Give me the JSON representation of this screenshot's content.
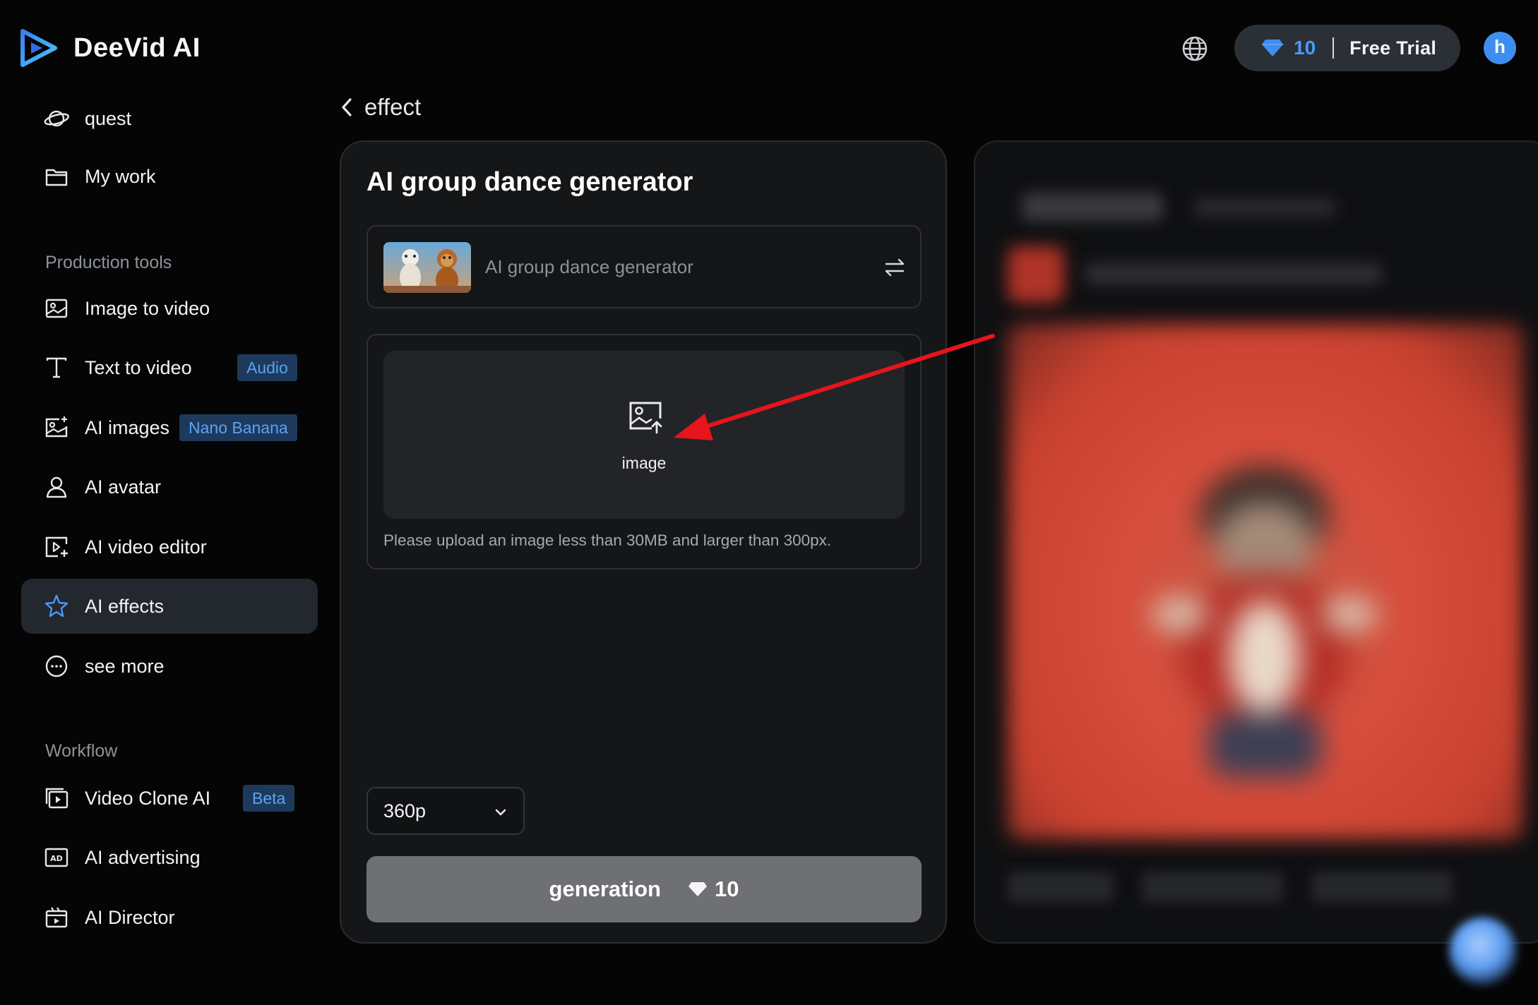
{
  "app": {
    "name": "DeeVid AI"
  },
  "header": {
    "credits": "10",
    "trial_label": "Free Trial",
    "avatar_initial": "h"
  },
  "sidebar": {
    "top_items": [
      {
        "label": "quest",
        "icon": "planet-icon"
      },
      {
        "label": "My work",
        "icon": "folder-icon"
      }
    ],
    "production_title": "Production tools",
    "production_items": [
      {
        "label": "Image to video",
        "icon": "image-icon"
      },
      {
        "label": "Text to video",
        "icon": "text-icon",
        "badge": "Audio"
      },
      {
        "label": "AI images",
        "icon": "sparkle-image-icon",
        "badge": "Nano Banana"
      },
      {
        "label": "AI avatar",
        "icon": "user-icon"
      },
      {
        "label": "AI video editor",
        "icon": "video-edit-icon"
      },
      {
        "label": "AI effects",
        "icon": "star-icon",
        "active": true
      },
      {
        "label": "see more",
        "icon": "more-icon"
      }
    ],
    "workflow_title": "Workflow",
    "workflow_items": [
      {
        "label": "Video Clone AI",
        "icon": "video-clone-icon",
        "badge": "Beta"
      },
      {
        "label": "AI advertising",
        "icon": "ad-icon"
      },
      {
        "label": "AI Director",
        "icon": "clapper-icon"
      }
    ]
  },
  "main": {
    "back_label": "effect",
    "panel_title": "AI group dance generator",
    "effect_name": "AI group dance generator",
    "upload_label": "image",
    "upload_hint": "Please upload an image less than 30MB and larger than 300px.",
    "resolution": "360p",
    "generate_label": "generation",
    "generate_cost": "10"
  },
  "colors": {
    "accent": "#4a9af5",
    "annotation_arrow": "#e8141b",
    "background": "#050505",
    "panel": "#151618"
  }
}
